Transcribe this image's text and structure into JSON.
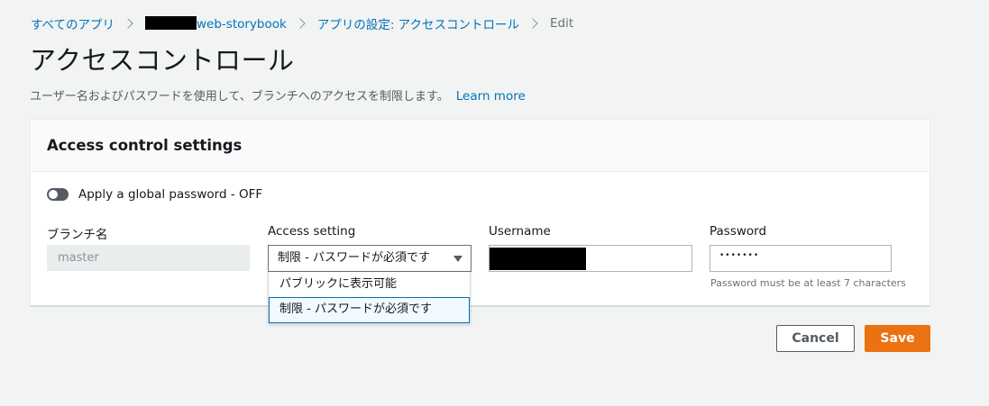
{
  "breadcrumb": {
    "item1": "すべてのアプリ",
    "item2": "web-storybook",
    "item3": "アプリの設定: アクセスコントロール",
    "item4": "Edit"
  },
  "page": {
    "title": "アクセスコントロール",
    "description": "ユーザー名およびパスワードを使用して、ブランチへのアクセスを制限します。",
    "learn_more": "Learn more"
  },
  "panel": {
    "title": "Access control settings",
    "toggle_label": "Apply a global password - OFF",
    "toggle_on": false
  },
  "fields": {
    "branch_label": "ブランチ名",
    "branch_value": "master",
    "access_label": "Access setting",
    "access_value": "制限 - パスワードが必須です",
    "username_label": "Username",
    "password_label": "Password",
    "password_value": "•••••••",
    "password_hint": "Password must be at least 7 characters"
  },
  "dropdown": {
    "options": [
      "パブリックに表示可能",
      "制限 - パスワードが必須です"
    ],
    "selected_index": 1
  },
  "buttons": {
    "cancel": "Cancel",
    "save": "Save"
  },
  "colors": {
    "link": "#0073bb",
    "primary": "#ec7211",
    "background": "#f2f3f3"
  }
}
